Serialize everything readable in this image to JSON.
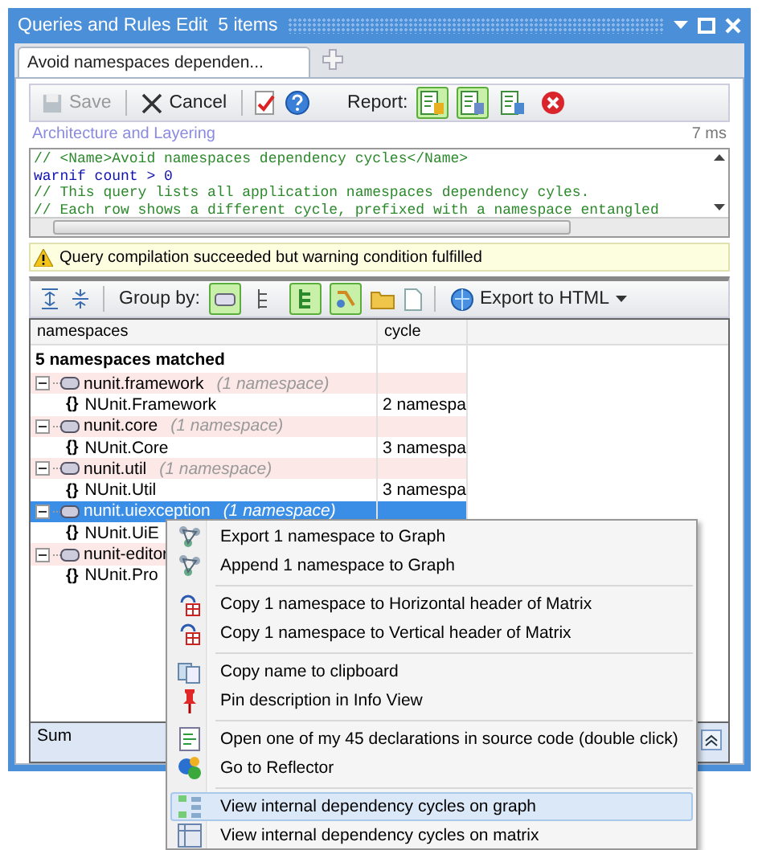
{
  "window": {
    "title": "Queries and Rules Edit  5 items"
  },
  "tabs": [
    {
      "label": "Avoid namespaces dependen...",
      "selected": true
    }
  ],
  "toolbar": {
    "save": {
      "label": "Save",
      "disabled": true
    },
    "cancel": {
      "label": "Cancel",
      "disabled": false
    },
    "report_label": "Report:",
    "report_buttons": [
      {
        "selected": true
      },
      {
        "selected": true
      },
      {
        "selected": false
      },
      {
        "selected": false
      }
    ]
  },
  "query": {
    "category": "Architecture and Layering",
    "duration": "7 ms",
    "code_lines": [
      {
        "kind": "comment",
        "text": "// <Name>Avoid namespaces dependency cycles</Name>"
      },
      {
        "kind": "code",
        "text": "warnif count > 0"
      },
      {
        "kind": "comment",
        "text": "// This query lists all application namespaces dependency cyles."
      },
      {
        "kind": "comment",
        "text": "// Each row shows a different cycle, prefixed with a namespace entangled"
      }
    ]
  },
  "status_message": "Query compilation succeeded but warning condition fulfilled",
  "results_toolbar": {
    "group_by_label": "Group by:",
    "group_buttons": [
      {
        "selected": true
      },
      {
        "selected": false
      },
      {
        "selected": true
      },
      {
        "selected": true
      }
    ],
    "export_label": "Export to HTML"
  },
  "table": {
    "columns": [
      "namespaces",
      "cycle"
    ],
    "summary": "5 namespaces matched",
    "rows": [
      {
        "name": "nunit.framework",
        "count": "(1 namespace)",
        "selected": false,
        "children": [
          {
            "glyph": "{}",
            "name": "NUnit.Framework",
            "cycle": "2 namespa"
          }
        ]
      },
      {
        "name": "nunit.core",
        "count": "(1 namespace)",
        "selected": false,
        "children": [
          {
            "glyph": "{}",
            "name": "NUnit.Core",
            "cycle": "3 namespa"
          }
        ]
      },
      {
        "name": "nunit.util",
        "count": "(1 namespace)",
        "selected": false,
        "children": [
          {
            "glyph": "{}",
            "name": "NUnit.Util",
            "cycle": "3 namespa"
          }
        ]
      },
      {
        "name": "nunit.uiexception",
        "count": "(1 namespace)",
        "selected": true,
        "children": [
          {
            "glyph": "{}",
            "name": "NUnit.UiE"
          }
        ]
      },
      {
        "name": "nunit-editor",
        "selected": false,
        "children": [
          {
            "glyph": "{}",
            "name": "NUnit.Pro"
          }
        ]
      }
    ],
    "footer": "Sum"
  },
  "context_menu": {
    "groups": [
      [
        {
          "label": "Export 1 namespace to Graph",
          "selected": false
        },
        {
          "label": "Append 1 namespace to Graph",
          "selected": false
        }
      ],
      [
        {
          "label": "Copy 1 namespace to Horizontal header of Matrix",
          "selected": false
        },
        {
          "label": "Copy 1 namespace to Vertical header of Matrix",
          "selected": false
        }
      ],
      [
        {
          "label": "Copy name to clipboard",
          "selected": false
        },
        {
          "label": "Pin description in Info View",
          "selected": false
        }
      ],
      [
        {
          "label": "Open one of my 45 declarations in source code (double click)",
          "selected": false
        },
        {
          "label": "Go to Reflector",
          "selected": false
        }
      ],
      [
        {
          "label": "View internal dependency cycles on graph",
          "selected": true
        },
        {
          "label": "View internal dependency cycles on matrix",
          "selected": false
        }
      ]
    ]
  }
}
